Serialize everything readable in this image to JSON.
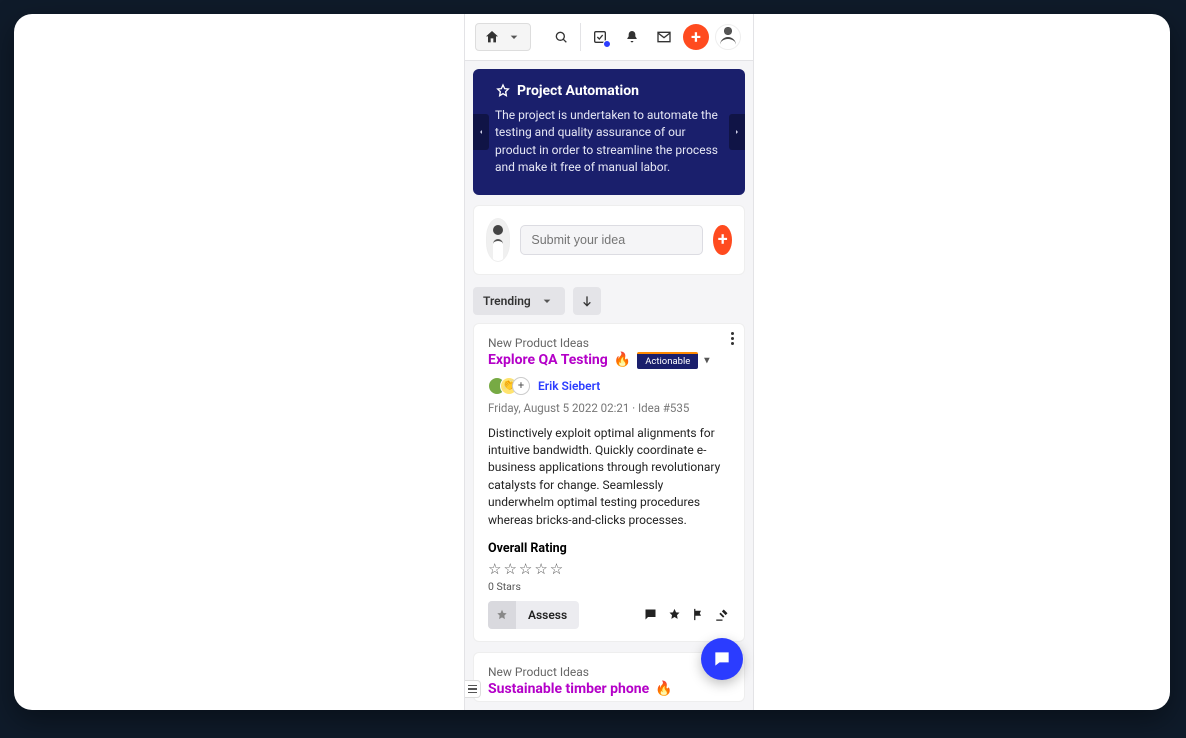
{
  "nav": {
    "home_label": "Home"
  },
  "hero": {
    "title": "Project Automation",
    "description": "The project is undertaken to automate the testing and quality assurance of our product in order to streamline the process and make it free of manual labor."
  },
  "submit": {
    "placeholder": "Submit your idea"
  },
  "filter": {
    "label": "Trending"
  },
  "cards": [
    {
      "category": "New Product Ideas",
      "title": "Explore QA Testing",
      "emoji": "🔥",
      "status": "Actionable",
      "author": "Erik Siebert",
      "timestamp": "Friday, August 5 2022 02:21",
      "idea_ref": "Idea #535",
      "body": "Distinctively exploit optimal alignments for intuitive bandwidth. Quickly coordinate e-business applications through revolutionary catalysts for change. Seamlessly underwhelm optimal testing procedures whereas bricks-and-clicks processes.",
      "rating_heading": "Overall Rating",
      "stars_text": "0 Stars",
      "assess_label": "Assess"
    },
    {
      "category": "New Product Ideas",
      "title": "Sustainable timber phone",
      "emoji": "🔥"
    }
  ]
}
